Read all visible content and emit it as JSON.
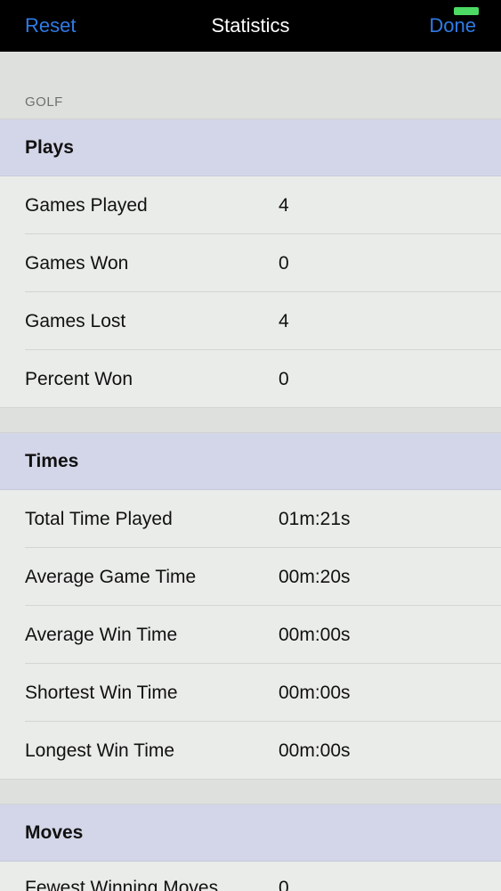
{
  "navbar": {
    "reset_label": "Reset",
    "title": "Statistics",
    "done_label": "Done"
  },
  "section_caption": "GOLF",
  "groups": [
    {
      "title": "Plays",
      "rows": [
        {
          "label": "Games Played",
          "value": "4"
        },
        {
          "label": "Games Won",
          "value": "0"
        },
        {
          "label": "Games Lost",
          "value": "4"
        },
        {
          "label": "Percent Won",
          "value": "0"
        }
      ]
    },
    {
      "title": "Times",
      "rows": [
        {
          "label": "Total Time Played",
          "value": "01m:21s"
        },
        {
          "label": "Average Game Time",
          "value": "00m:20s"
        },
        {
          "label": "Average Win Time",
          "value": "00m:00s"
        },
        {
          "label": "Shortest Win Time",
          "value": "00m:00s"
        },
        {
          "label": "Longest Win Time",
          "value": "00m:00s"
        }
      ]
    },
    {
      "title": "Moves",
      "rows": [
        {
          "label": "Fewest Winning Moves",
          "value": "0"
        }
      ]
    }
  ],
  "colors": {
    "accent": "#2f7be6",
    "group_header_bg": "#d3d6e8",
    "row_bg": "#e9ece8",
    "page_bg": "#dde0dc"
  }
}
